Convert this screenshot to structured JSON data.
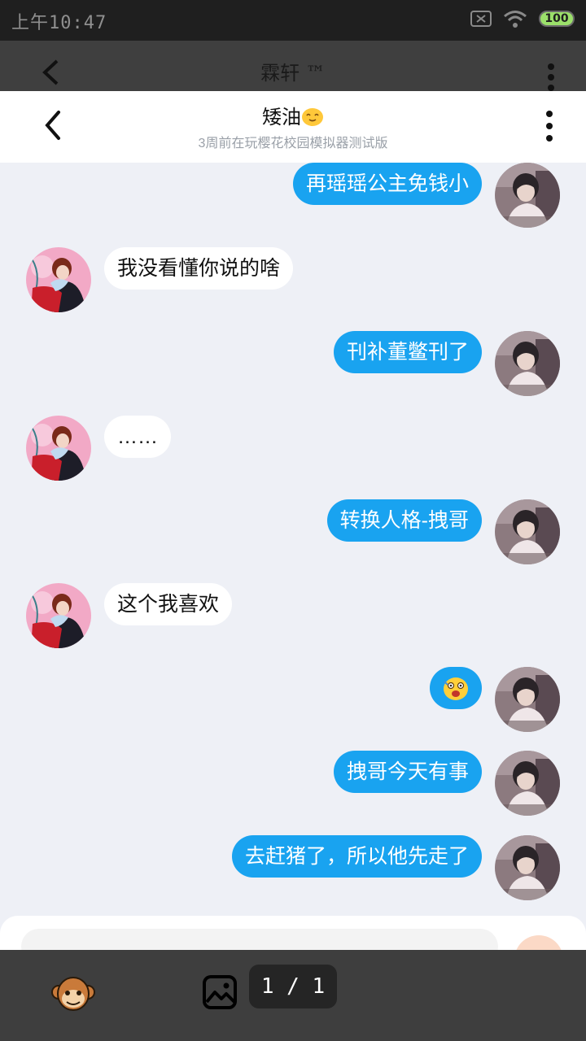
{
  "status_bar": {
    "time": "上午10:47",
    "battery": "100",
    "icons": [
      "sim-off-icon",
      "wifi-icon",
      "battery-icon"
    ]
  },
  "background_app": {
    "title": "霖轩 ™"
  },
  "header": {
    "title": "矮油",
    "title_emoji": "smiling-face-emoji",
    "subtitle": "3周前在玩樱花校园模拟器测试版"
  },
  "messages": [
    {
      "side": "right",
      "text": "再瑶瑶公主免钱小"
    },
    {
      "side": "left",
      "text": "我没看懂你说的啥"
    },
    {
      "side": "right",
      "text": "刊补董鳖刊了"
    },
    {
      "side": "left",
      "text": "……"
    },
    {
      "side": "right",
      "text": "转换人格-拽哥"
    },
    {
      "side": "left",
      "text": "这个我喜欢"
    },
    {
      "side": "right",
      "text": "",
      "emoji": "shocked-face-emoji"
    },
    {
      "side": "right",
      "text": "拽哥今天有事"
    },
    {
      "side": "right",
      "text": "去赶猪了，所以他先走了"
    }
  ],
  "bottom_bar": {
    "pager": "1 / 1"
  },
  "colors": {
    "outgoing_bubble": "#19a3f0",
    "incoming_bubble": "#ffffff",
    "chat_background": "#eef0f6",
    "bottom_bar": "#3e3e3e"
  }
}
